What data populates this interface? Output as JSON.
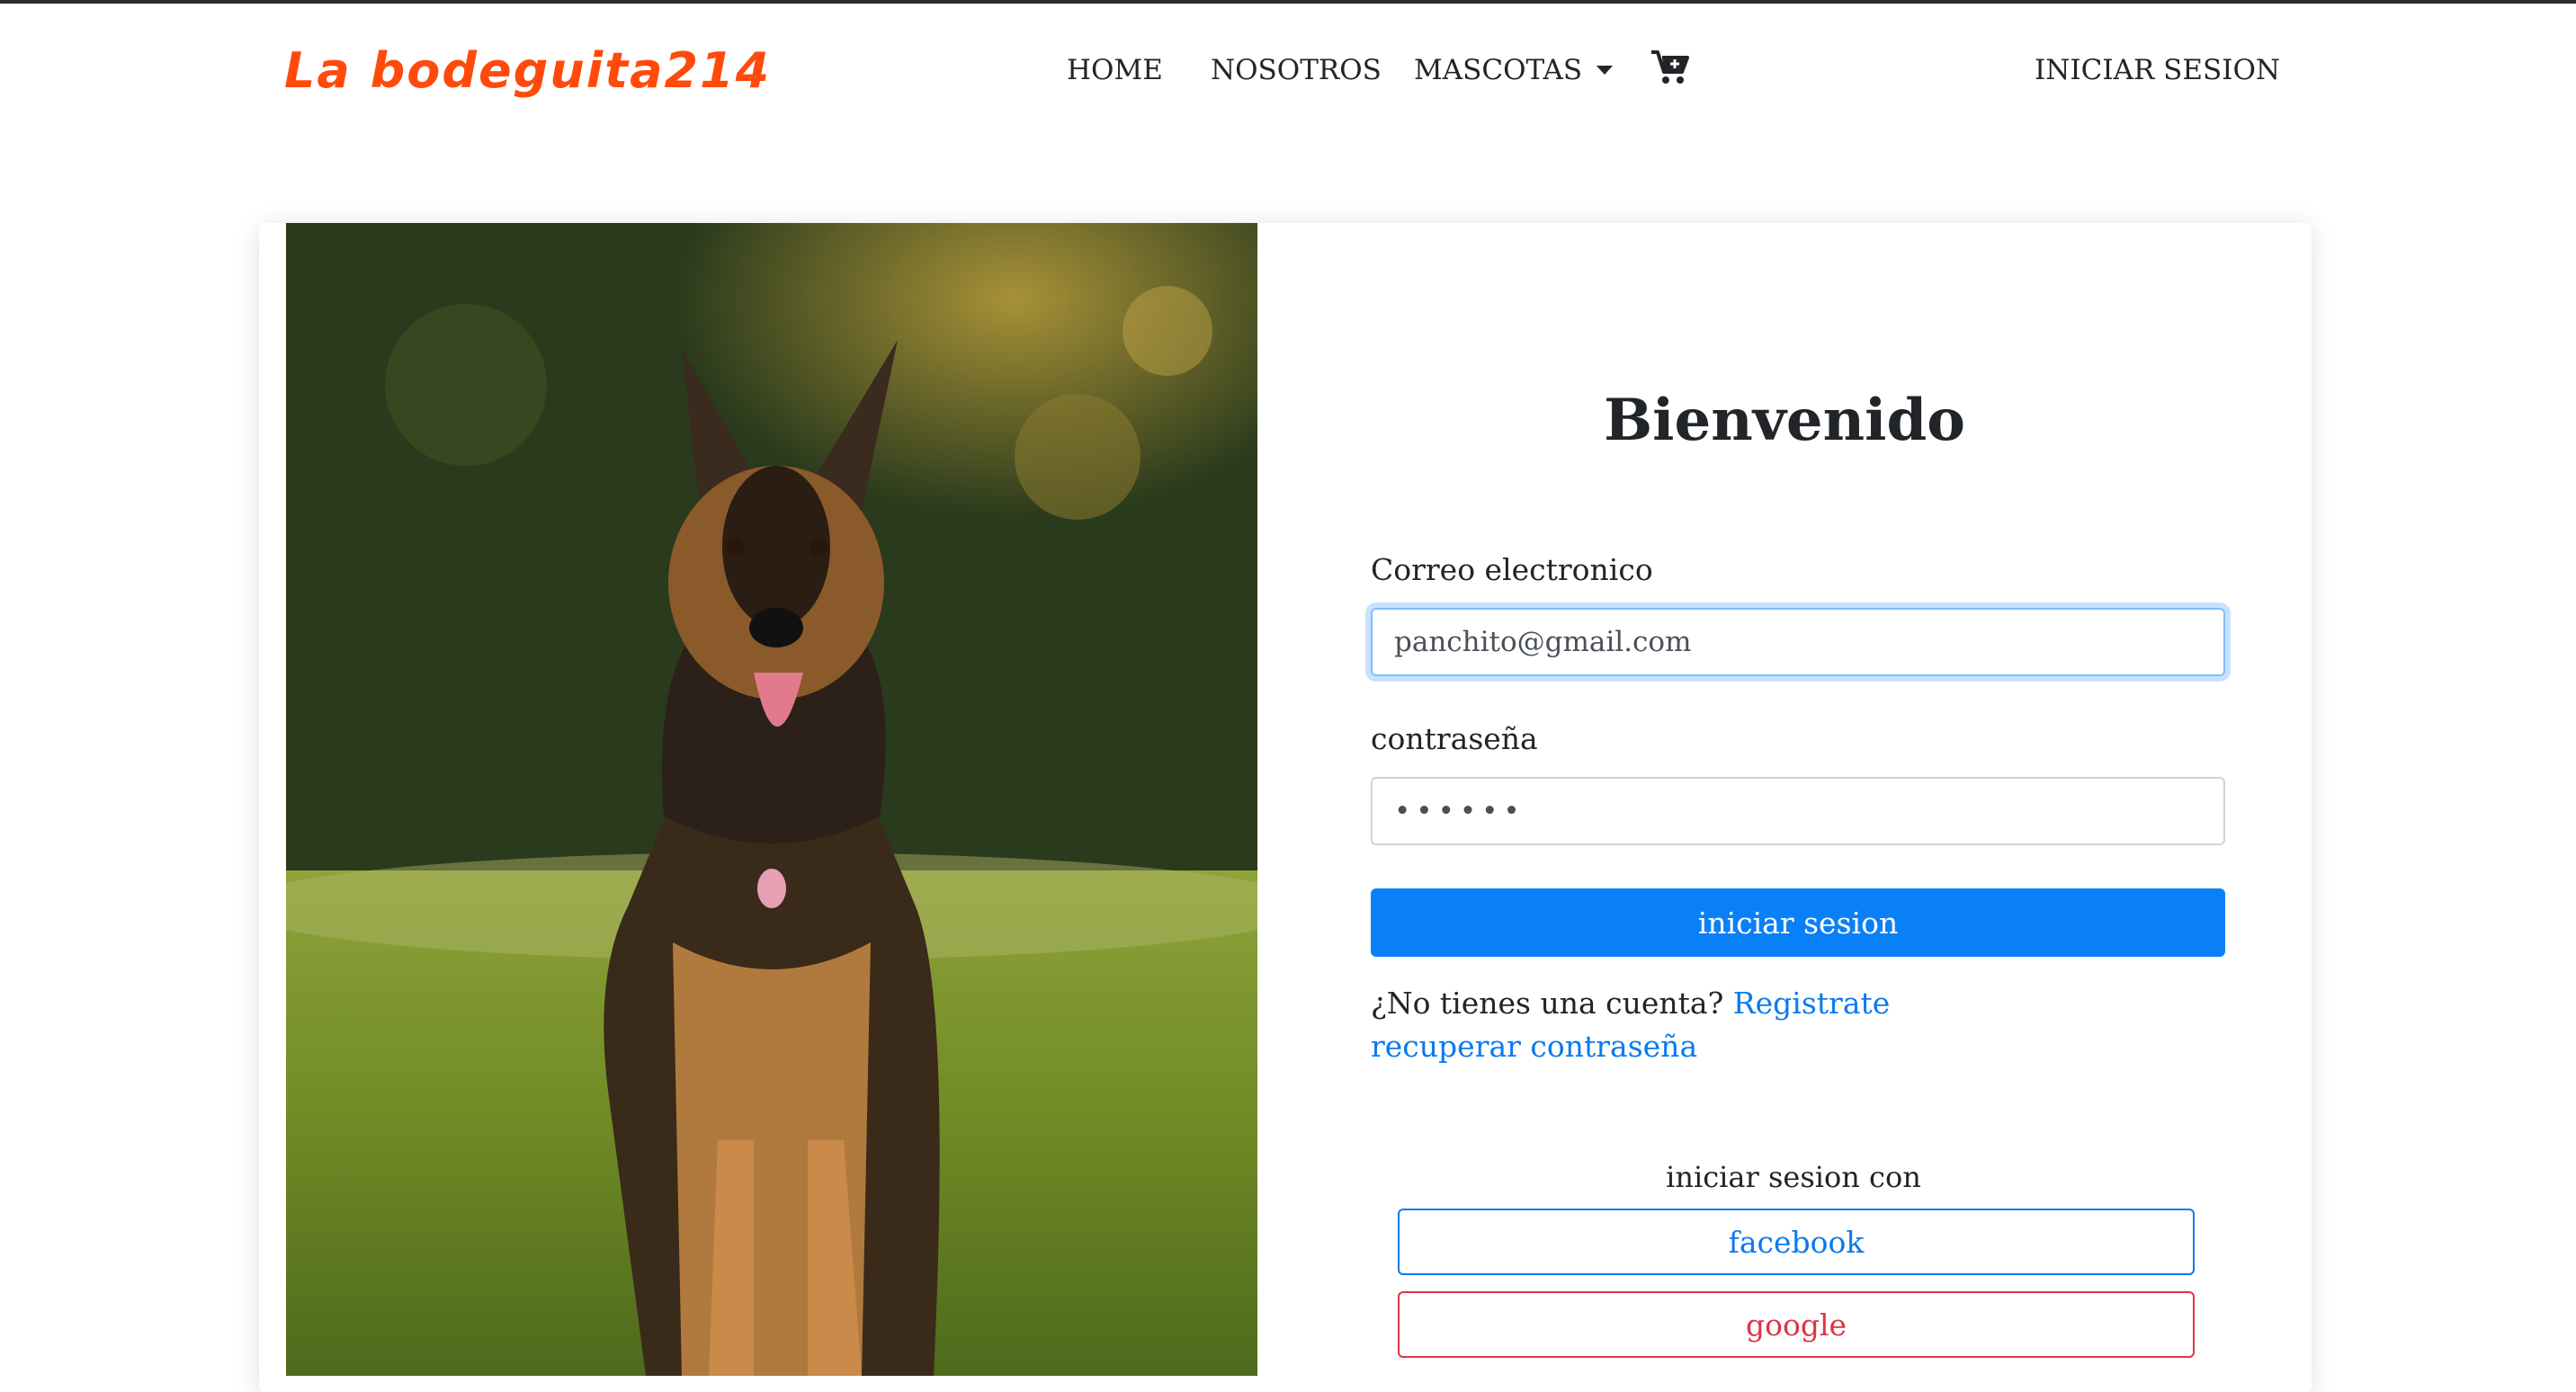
{
  "navbar": {
    "brand": "La bodeguita214",
    "items": [
      {
        "label": "HOME"
      },
      {
        "label": "NOSOTROS"
      },
      {
        "label": "MASCOTAS"
      }
    ],
    "cart_icon": "cart-plus-icon",
    "login_link": "INICIAR SESION"
  },
  "login": {
    "title": "Bienvenido",
    "email_label": "Correo electronico",
    "email_value": "panchito@gmail.com",
    "password_label": "contraseña",
    "password_value": "••••••",
    "submit_label": "iniciar sesion",
    "no_account_text": "¿No tienes una cuenta?",
    "register_link": "Registrate",
    "recover_link": "recuperar contraseña",
    "social_label": "iniciar sesion con",
    "facebook_label": "facebook",
    "google_label": "google"
  },
  "colors": {
    "brand": "#ff4a0b",
    "primary": "#0a80f8",
    "link": "#0a7af0",
    "danger": "#dc3545"
  }
}
